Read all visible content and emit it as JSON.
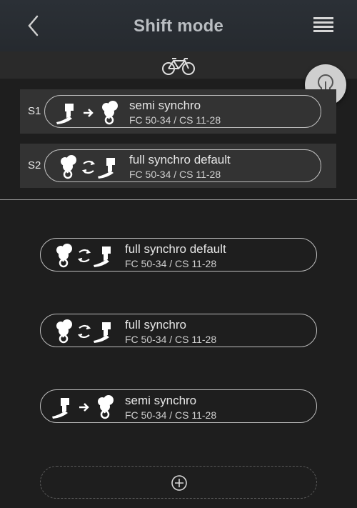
{
  "header": {
    "title": "Shift mode"
  },
  "colors": {
    "header_bg": "#262a2f",
    "body_bg": "#1e1e1e",
    "slot_bg": "#333333",
    "hint_bg": "#cfcfcf"
  },
  "icons": {
    "back": "chevron-left-icon",
    "menu": "list-menu-icon",
    "bike": "bicycle-icon",
    "hint": "lightbulb-icon",
    "add": "plus-circle-icon"
  },
  "slots": [
    {
      "label": "S1",
      "mode": "semi synchro",
      "gears": "FC 50-34 / CS 11-28",
      "icon_type": "semi"
    },
    {
      "label": "S2",
      "mode": "full synchro default",
      "gears": "FC 50-34 / CS 11-28",
      "icon_type": "full"
    }
  ],
  "modes": [
    {
      "mode": "full synchro default",
      "gears": "FC 50-34 / CS 11-28",
      "icon_type": "full"
    },
    {
      "mode": "full synchro",
      "gears": "FC 50-34 / CS 11-28",
      "icon_type": "full"
    },
    {
      "mode": "semi synchro",
      "gears": "FC 50-34 / CS 11-28",
      "icon_type": "semi"
    }
  ]
}
